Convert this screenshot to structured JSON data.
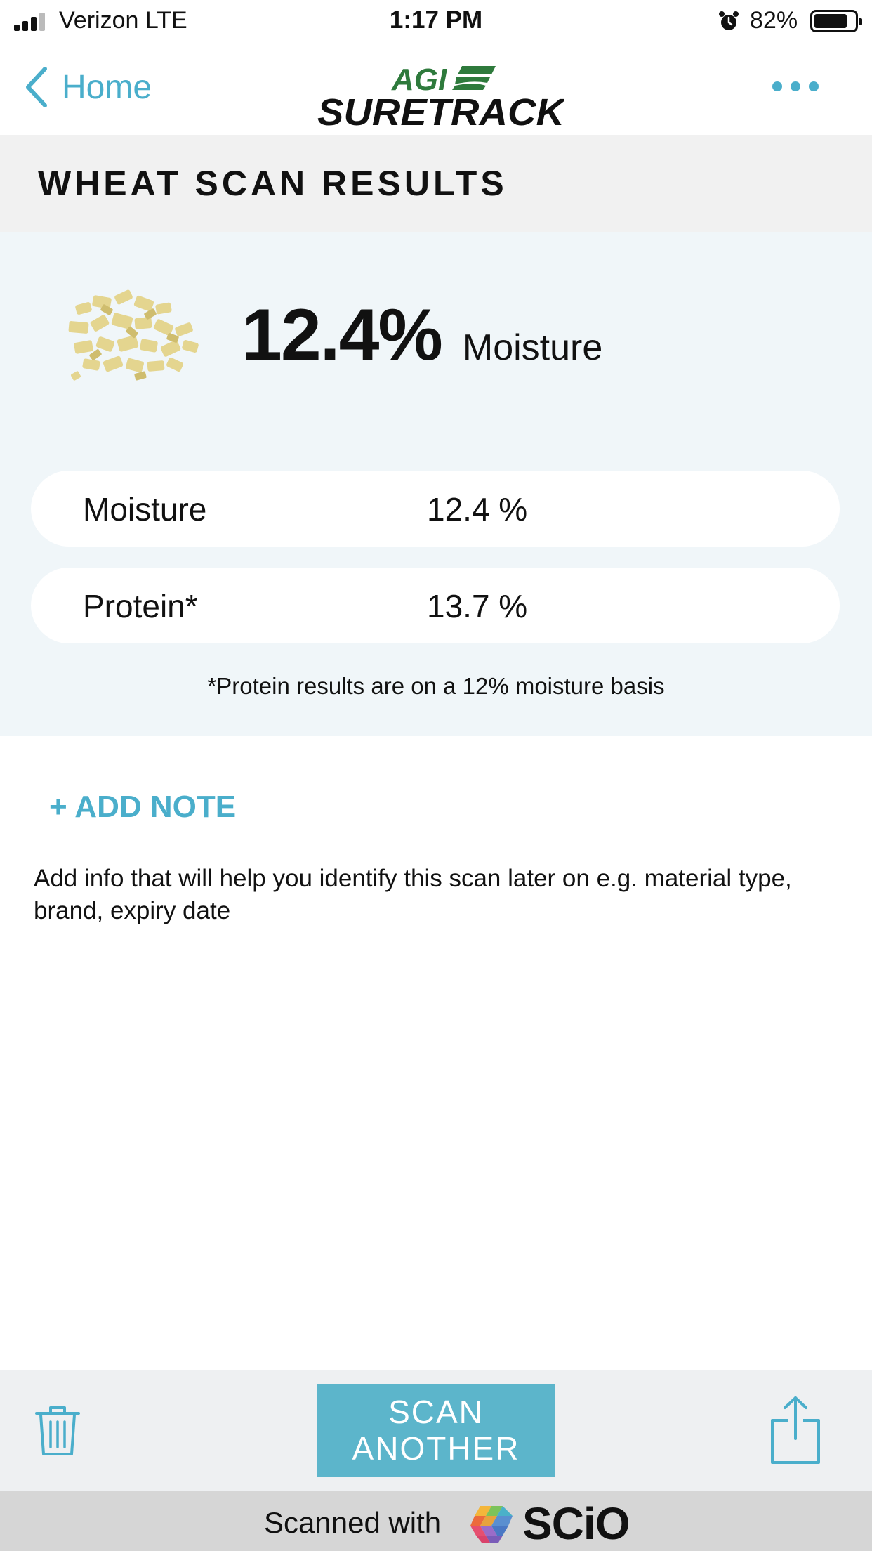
{
  "status_bar": {
    "carrier": "Verizon  LTE",
    "time": "1:17 PM",
    "battery_percent": "82%",
    "battery_level": 0.82
  },
  "nav": {
    "back_label": "Home",
    "logo_line1": "AGI",
    "logo_line2": "SURETRACK",
    "more_icon": "ellipsis-icon"
  },
  "page": {
    "title": "WHEAT SCAN RESULTS"
  },
  "results": {
    "headline_value": "12.4%",
    "headline_unit": "Moisture",
    "rows": [
      {
        "label": "Moisture",
        "value": "12.4 %"
      },
      {
        "label": "Protein*",
        "value": "13.7 %"
      }
    ],
    "footnote": "*Protein results are on a 12% moisture basis"
  },
  "notes": {
    "add_label": "+ ADD NOTE",
    "help_text": "Add info that will help you identify this scan later on e.g. material type, brand, expiry date"
  },
  "toolbar": {
    "scan_line1": "SCAN",
    "scan_line2": "ANOTHER",
    "trash_icon": "trash-icon",
    "share_icon": "share-icon"
  },
  "footer": {
    "scanned_with": "Scanned with",
    "brand": "SCiO"
  },
  "colors": {
    "accent": "#4aaecb",
    "button": "#5cb5cb",
    "logo_green": "#2e7a3c"
  }
}
